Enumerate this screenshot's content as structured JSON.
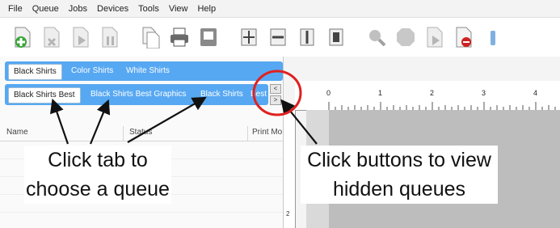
{
  "menu": [
    "File",
    "Queue",
    "Jobs",
    "Devices",
    "Tools",
    "View",
    "Help"
  ],
  "tabs_row1": [
    "Black Shirts",
    "Color Shirts",
    "White Shirts"
  ],
  "tabs_row2": [
    "Black Shirts Best",
    "Black Shirts Best Graphics",
    "Black Shirts",
    "Best"
  ],
  "scroll_buttons": [
    "<",
    ">"
  ],
  "columns": [
    "Name",
    "Status",
    "Print Mo"
  ],
  "ruler_marks": [
    "0",
    "1",
    "2",
    "3",
    "4"
  ],
  "vruler_label": "2",
  "callouts": {
    "left": "Click tab to choose a queue",
    "right": "Click buttons to view hidden queues"
  },
  "colors": {
    "tab_blue": "#57a8f2",
    "highlight_circle": "#e02020"
  }
}
